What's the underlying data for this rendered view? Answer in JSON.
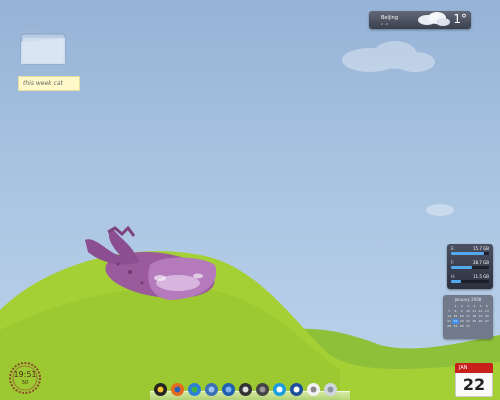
{
  "desktop": {
    "folder": {
      "label": "this week cat"
    },
    "weather": {
      "city": "Beijing",
      "sub": "2 - 0",
      "temp": "1°"
    },
    "drives": [
      {
        "label": "E:",
        "size": "15.7 GB",
        "fill": 0.88
      },
      {
        "label": "F:",
        "size": "28.7 GB",
        "fill": 0.55
      },
      {
        "label": "H:",
        "size": "11.5 GB",
        "fill": 0.25
      }
    ],
    "calendar_widget": {
      "header": "January 2008",
      "days": [
        "1",
        "2",
        "3",
        "4",
        "5",
        "6",
        "7",
        "8",
        "9",
        "10",
        "11",
        "12",
        "13",
        "14",
        "15",
        "16",
        "17",
        "18",
        "19",
        "20",
        "21",
        "22",
        "23",
        "24",
        "25",
        "26",
        "27",
        "28",
        "29",
        "30",
        "31"
      ],
      "today": "22"
    },
    "clock": {
      "time": "19:51",
      "seconds": "50"
    },
    "calendar_tile": {
      "month": "JAN",
      "day": "22"
    },
    "dock": {
      "icons": [
        "qq-icon",
        "firefox-icon",
        "messenger-icon",
        "webcam-icon",
        "media-player-icon",
        "clapper-icon",
        "disc-icon",
        "skype-icon",
        "bittorrent-icon",
        "ipod-icon",
        "recycle-bin-icon"
      ]
    }
  }
}
